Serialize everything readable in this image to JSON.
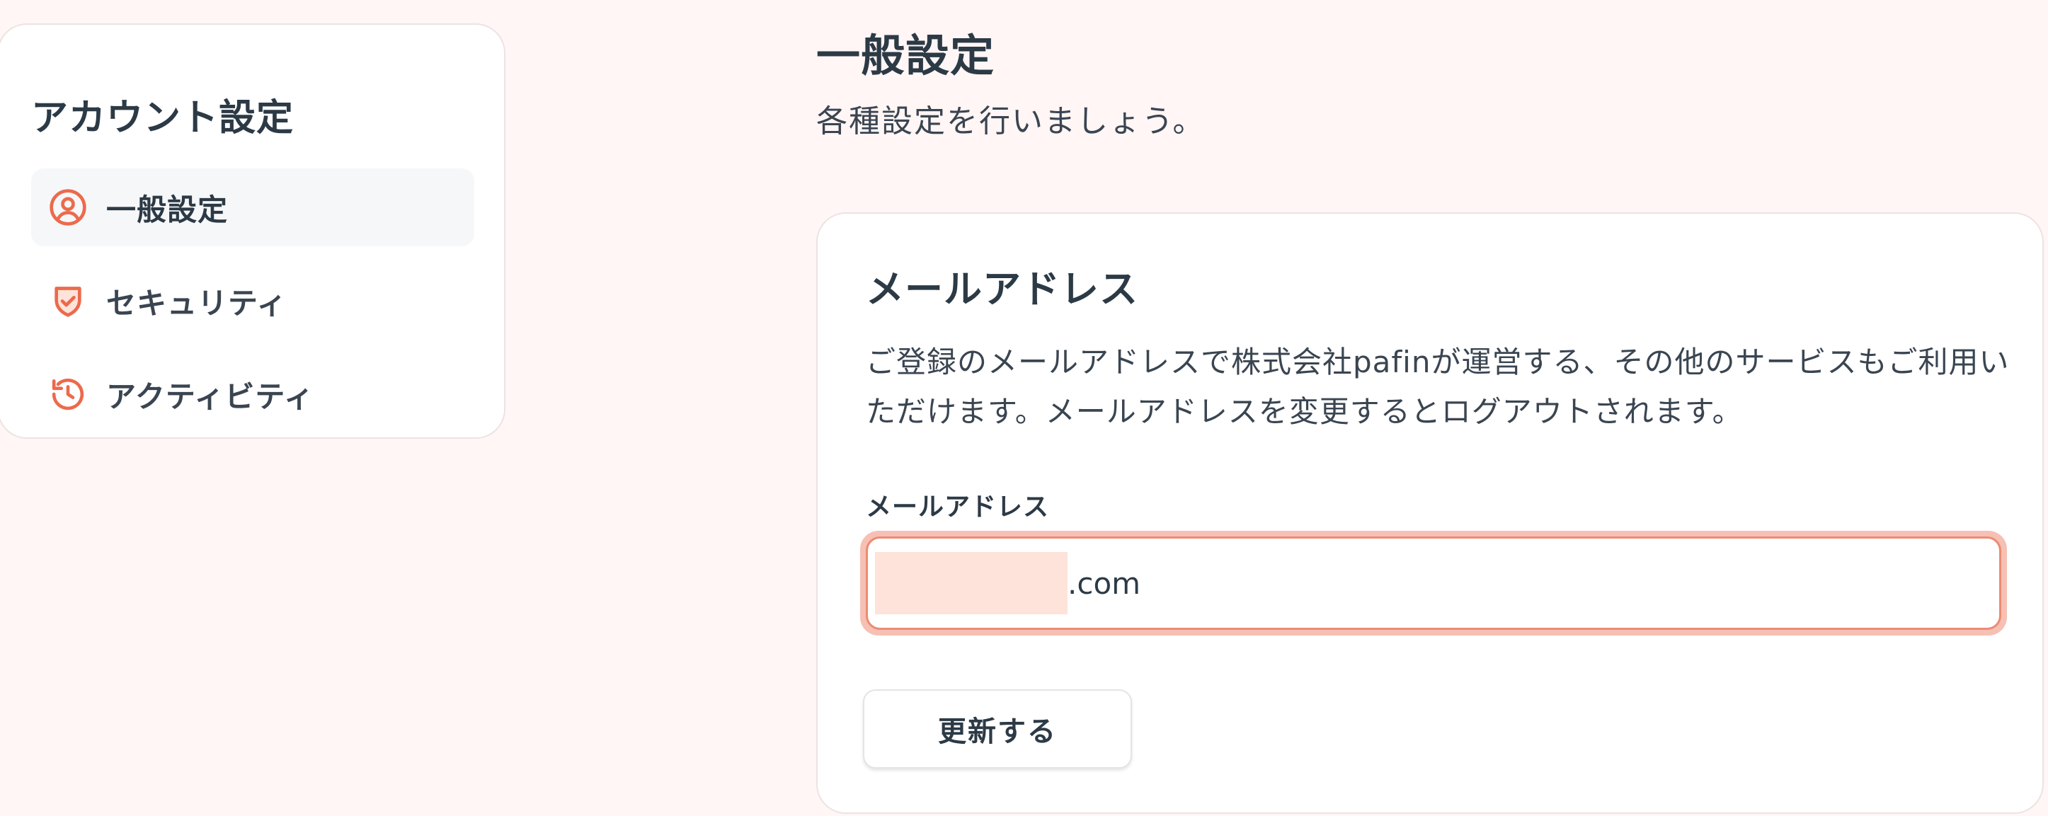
{
  "sidebar": {
    "title": "アカウント設定",
    "items": [
      {
        "label": "一般設定",
        "icon": "user-circle-icon",
        "active": true
      },
      {
        "label": "セキュリティ",
        "icon": "shield-check-icon",
        "active": false
      },
      {
        "label": "アクティビティ",
        "icon": "history-clock-icon",
        "active": false
      }
    ]
  },
  "header": {
    "title": "一般設定",
    "subtitle": "各種設定を行いましょう。"
  },
  "email_card": {
    "title": "メールアドレス",
    "description": "ご登録のメールアドレスで株式会社pafinが運営する、その他のサービスもご利用いただけます。メールアドレスを変更するとログアウトされます。",
    "field_label": "メールアドレス",
    "email_value_visible": ".com",
    "update_button_label": "更新する"
  },
  "colors": {
    "accent": "#ec6a4c",
    "background": "#fff6f5",
    "card": "#ffffff",
    "text": "#2c3a46",
    "input_focus_border": "#ec8b72",
    "input_focus_ring": "#f6c0b4"
  }
}
